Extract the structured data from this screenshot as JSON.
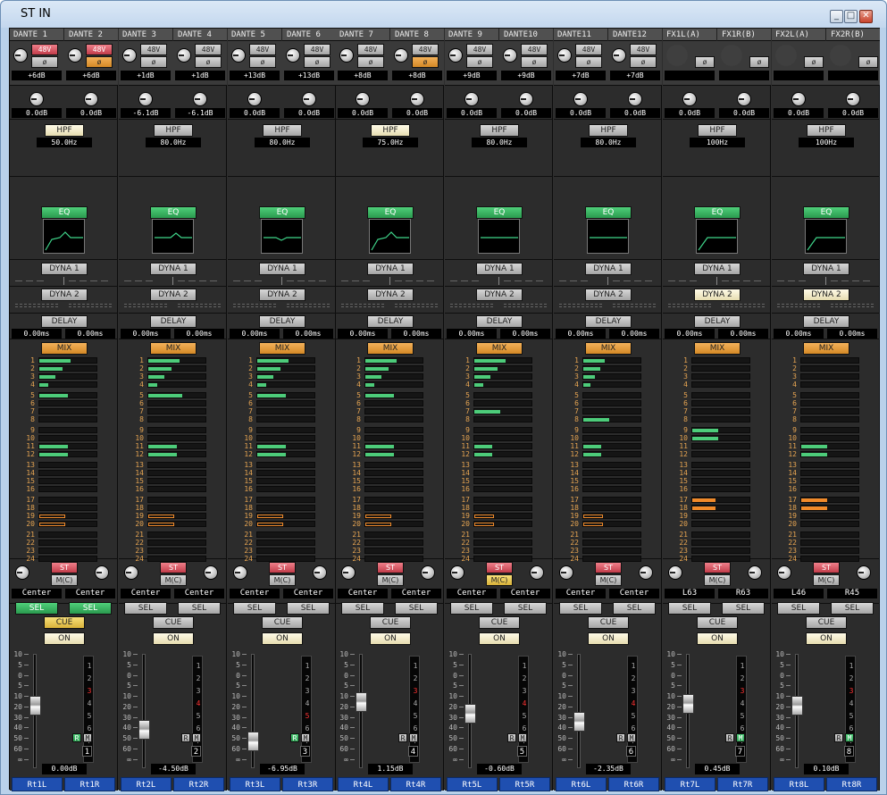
{
  "window": {
    "title": "ST IN"
  },
  "bus_numbers": [
    "1",
    "2",
    "3",
    "4",
    "5",
    "6",
    "7",
    "8",
    "9",
    "10",
    "11",
    "12",
    "13",
    "14",
    "15",
    "16",
    "17",
    "18",
    "19",
    "20",
    "21",
    "22",
    "23",
    "24"
  ],
  "fader_scale": [
    "10",
    "5",
    "0",
    "5",
    "10",
    "20",
    "30",
    "40",
    "50",
    "60",
    "∞"
  ],
  "meter_scale": [
    "1",
    "2",
    "3",
    "4",
    "5",
    "6",
    "7",
    "8"
  ],
  "labels": {
    "hpf": "HPF",
    "eq": "EQ",
    "dyna1": "DYNA 1",
    "dyna2": "DYNA 2",
    "delay": "DELAY",
    "mix": "MIX",
    "st": "ST",
    "mono": "M(C)",
    "sel": "SEL",
    "cue": "CUE",
    "on": "ON",
    "ph": "48V",
    "phase": "ø",
    "r": "R",
    "m": "M"
  },
  "colors": {
    "send_green": "#4dcc7a",
    "send_orange": "#f08a2a",
    "meter_red": "#ff3333"
  },
  "strips": [
    {
      "name_l": "DANTE 1",
      "name_r": "DANTE 2",
      "gain_l": "+6dB",
      "gain_r": "+6dB",
      "trim_l": "0.0dB",
      "trim_r": "0.0dB",
      "hpf": "50.0Hz",
      "hpf_on": true,
      "eq_curve": "hpf-peak",
      "dyna2_on": false,
      "delay_l": "0.00ms",
      "delay_r": "0.00ms",
      "pan_l": "Center",
      "pan_r": "Center",
      "sel_on": true,
      "cue_on": true,
      "mono_on": false,
      "fader_db": "0.00dB",
      "fader_level": 0.78,
      "number": "1",
      "patch_l": "Rt1L",
      "patch_r": "Rt1R",
      "r_on": true,
      "m_on": false,
      "ph_l": "red",
      "ph_r": "red",
      "phase_r_on": true,
      "has_input": true,
      "sends": [
        [
          0.55,
          "g"
        ],
        [
          0.4,
          "g"
        ],
        [
          0.28,
          "g"
        ],
        [
          0.15,
          "g"
        ],
        [
          0.5,
          "g"
        ],
        [
          0,
          ""
        ],
        [
          0,
          ""
        ],
        [
          0,
          ""
        ],
        [
          0,
          ""
        ],
        [
          0,
          ""
        ],
        [
          0.5,
          "g"
        ],
        [
          0.5,
          "g"
        ],
        [
          0,
          ""
        ],
        [
          0,
          ""
        ],
        [
          0,
          ""
        ],
        [
          0,
          ""
        ],
        [
          0,
          ""
        ],
        [
          0,
          ""
        ],
        [
          0.45,
          "o"
        ],
        [
          0.45,
          "o"
        ],
        [
          0,
          ""
        ],
        [
          0,
          ""
        ],
        [
          0,
          ""
        ],
        [
          0,
          ""
        ]
      ]
    },
    {
      "name_l": "DANTE 3",
      "name_r": "DANTE 4",
      "gain_l": "+1dB",
      "gain_r": "+1dB",
      "trim_l": "-6.1dB",
      "trim_r": "-6.1dB",
      "hpf": "80.0Hz",
      "hpf_on": false,
      "eq_curve": "peak",
      "dyna2_on": false,
      "delay_l": "0.00ms",
      "delay_r": "0.00ms",
      "pan_l": "Center",
      "pan_r": "Center",
      "sel_on": false,
      "cue_on": false,
      "mono_on": false,
      "fader_db": "-4.50dB",
      "fader_level": 0.66,
      "number": "2",
      "patch_l": "Rt2L",
      "patch_r": "Rt2R",
      "r_on": false,
      "m_on": false,
      "ph_l": "grey",
      "ph_r": "grey",
      "phase_r_on": false,
      "has_input": true,
      "sends": [
        [
          0.55,
          "g"
        ],
        [
          0.4,
          "g"
        ],
        [
          0.28,
          "g"
        ],
        [
          0.15,
          "g"
        ],
        [
          0.6,
          "g"
        ],
        [
          0,
          ""
        ],
        [
          0,
          ""
        ],
        [
          0,
          ""
        ],
        [
          0,
          ""
        ],
        [
          0,
          ""
        ],
        [
          0.5,
          "g"
        ],
        [
          0.5,
          "g"
        ],
        [
          0,
          ""
        ],
        [
          0,
          ""
        ],
        [
          0,
          ""
        ],
        [
          0,
          ""
        ],
        [
          0,
          ""
        ],
        [
          0,
          ""
        ],
        [
          0.45,
          "o"
        ],
        [
          0.45,
          "o"
        ],
        [
          0,
          ""
        ],
        [
          0,
          ""
        ],
        [
          0,
          ""
        ],
        [
          0,
          ""
        ]
      ]
    },
    {
      "name_l": "DANTE 5",
      "name_r": "DANTE 6",
      "gain_l": "+13dB",
      "gain_r": "+13dB",
      "trim_l": "0.0dB",
      "trim_r": "0.0dB",
      "hpf": "80.0Hz",
      "hpf_on": false,
      "eq_curve": "dip",
      "dyna2_on": false,
      "delay_l": "0.00ms",
      "delay_r": "0.00ms",
      "pan_l": "Center",
      "pan_r": "Center",
      "sel_on": false,
      "cue_on": false,
      "mono_on": false,
      "fader_db": "-6.95dB",
      "fader_level": 0.6,
      "number": "3",
      "patch_l": "Rt3L",
      "patch_r": "Rt3R",
      "r_on": true,
      "m_on": false,
      "ph_l": "grey",
      "ph_r": "grey",
      "phase_r_on": false,
      "has_input": true,
      "sends": [
        [
          0.55,
          "g"
        ],
        [
          0.4,
          "g"
        ],
        [
          0.28,
          "g"
        ],
        [
          0.15,
          "g"
        ],
        [
          0.5,
          "g"
        ],
        [
          0,
          ""
        ],
        [
          0,
          ""
        ],
        [
          0,
          ""
        ],
        [
          0,
          ""
        ],
        [
          0,
          ""
        ],
        [
          0.5,
          "g"
        ],
        [
          0.5,
          "g"
        ],
        [
          0,
          ""
        ],
        [
          0,
          ""
        ],
        [
          0,
          ""
        ],
        [
          0,
          ""
        ],
        [
          0,
          ""
        ],
        [
          0,
          ""
        ],
        [
          0.45,
          "o"
        ],
        [
          0.45,
          "o"
        ],
        [
          0,
          ""
        ],
        [
          0,
          ""
        ],
        [
          0,
          ""
        ],
        [
          0,
          ""
        ]
      ]
    },
    {
      "name_l": "DANTE 7",
      "name_r": "DANTE 8",
      "gain_l": "+8dB",
      "gain_r": "+8dB",
      "trim_l": "0.0dB",
      "trim_r": "0.0dB",
      "hpf": "75.0Hz",
      "hpf_on": true,
      "eq_curve": "hpf-peak",
      "dyna2_on": false,
      "delay_l": "0.00ms",
      "delay_r": "0.00ms",
      "pan_l": "Center",
      "pan_r": "Center",
      "sel_on": false,
      "cue_on": false,
      "mono_on": false,
      "fader_db": "1.15dB",
      "fader_level": 0.8,
      "number": "4",
      "patch_l": "Rt4L",
      "patch_r": "Rt4R",
      "r_on": false,
      "m_on": false,
      "ph_l": "grey",
      "ph_r": "grey",
      "phase_r_on": true,
      "has_input": true,
      "sends": [
        [
          0.55,
          "g"
        ],
        [
          0.4,
          "g"
        ],
        [
          0.28,
          "g"
        ],
        [
          0.15,
          "g"
        ],
        [
          0.5,
          "g"
        ],
        [
          0,
          ""
        ],
        [
          0,
          ""
        ],
        [
          0,
          ""
        ],
        [
          0,
          ""
        ],
        [
          0,
          ""
        ],
        [
          0.5,
          "g"
        ],
        [
          0.5,
          "g"
        ],
        [
          0,
          ""
        ],
        [
          0,
          ""
        ],
        [
          0,
          ""
        ],
        [
          0,
          ""
        ],
        [
          0,
          ""
        ],
        [
          0,
          ""
        ],
        [
          0.45,
          "o"
        ],
        [
          0.45,
          "o"
        ],
        [
          0,
          ""
        ],
        [
          0,
          ""
        ],
        [
          0,
          ""
        ],
        [
          0,
          ""
        ]
      ]
    },
    {
      "name_l": "DANTE 9",
      "name_r": "DANTE10",
      "gain_l": "+9dB",
      "gain_r": "+9dB",
      "trim_l": "0.0dB",
      "trim_r": "0.0dB",
      "hpf": "80.0Hz",
      "hpf_on": false,
      "eq_curve": "flat",
      "dyna2_on": false,
      "delay_l": "0.00ms",
      "delay_r": "0.00ms",
      "pan_l": "Center",
      "pan_r": "Center",
      "sel_on": false,
      "cue_on": false,
      "mono_on": true,
      "fader_db": "-0.60dB",
      "fader_level": 0.74,
      "number": "5",
      "patch_l": "Rt5L",
      "patch_r": "Rt5R",
      "r_on": false,
      "m_on": false,
      "ph_l": "grey",
      "ph_r": "grey",
      "phase_r_on": false,
      "has_input": true,
      "sends": [
        [
          0.55,
          "g"
        ],
        [
          0.4,
          "g"
        ],
        [
          0.28,
          "g"
        ],
        [
          0.15,
          "g"
        ],
        [
          0,
          ""
        ],
        [
          0,
          ""
        ],
        [
          0.45,
          "g"
        ],
        [
          0,
          ""
        ],
        [
          0,
          ""
        ],
        [
          0,
          ""
        ],
        [
          0.32,
          "g"
        ],
        [
          0.32,
          "g"
        ],
        [
          0,
          ""
        ],
        [
          0,
          ""
        ],
        [
          0,
          ""
        ],
        [
          0,
          ""
        ],
        [
          0,
          ""
        ],
        [
          0,
          ""
        ],
        [
          0.35,
          "o"
        ],
        [
          0.35,
          "o"
        ],
        [
          0,
          ""
        ],
        [
          0,
          ""
        ],
        [
          0,
          ""
        ],
        [
          0,
          ""
        ]
      ]
    },
    {
      "name_l": "DANTE11",
      "name_r": "DANTE12",
      "gain_l": "+7dB",
      "gain_r": "+7dB",
      "trim_l": "0.0dB",
      "trim_r": "0.0dB",
      "hpf": "80.0Hz",
      "hpf_on": false,
      "eq_curve": "flat",
      "dyna2_on": false,
      "delay_l": "0.00ms",
      "delay_r": "0.00ms",
      "pan_l": "Center",
      "pan_r": "Center",
      "sel_on": false,
      "cue_on": false,
      "mono_on": false,
      "fader_db": "-2.35dB",
      "fader_level": 0.7,
      "number": "6",
      "patch_l": "Rt6L",
      "patch_r": "Rt6R",
      "r_on": false,
      "m_on": false,
      "ph_l": "grey",
      "ph_r": "grey",
      "phase_r_on": false,
      "has_input": true,
      "sends": [
        [
          0.38,
          "g"
        ],
        [
          0.3,
          "g"
        ],
        [
          0.2,
          "g"
        ],
        [
          0.12,
          "g"
        ],
        [
          0,
          ""
        ],
        [
          0,
          ""
        ],
        [
          0,
          ""
        ],
        [
          0.45,
          "g"
        ],
        [
          0,
          ""
        ],
        [
          0,
          ""
        ],
        [
          0.32,
          "g"
        ],
        [
          0.32,
          "g"
        ],
        [
          0,
          ""
        ],
        [
          0,
          ""
        ],
        [
          0,
          ""
        ],
        [
          0,
          ""
        ],
        [
          0,
          ""
        ],
        [
          0,
          ""
        ],
        [
          0.35,
          "o"
        ],
        [
          0.35,
          "o"
        ],
        [
          0,
          ""
        ],
        [
          0,
          ""
        ],
        [
          0,
          ""
        ],
        [
          0,
          ""
        ]
      ]
    },
    {
      "name_l": "FX1L(A)",
      "name_r": "FX1R(B)",
      "gain_l": "",
      "gain_r": "",
      "trim_l": "0.0dB",
      "trim_r": "0.0dB",
      "hpf": "100Hz",
      "hpf_on": false,
      "eq_curve": "hpf",
      "dyna2_on": true,
      "delay_l": "0.00ms",
      "delay_r": "0.00ms",
      "pan_l": "L63",
      "pan_r": "R63",
      "sel_on": false,
      "cue_on": false,
      "mono_on": false,
      "fader_db": "0.45dB",
      "fader_level": 0.79,
      "number": "7",
      "patch_l": "Rt7L",
      "patch_r": "Rt7R",
      "r_on": false,
      "m_on": true,
      "ph_l": "none",
      "ph_r": "none",
      "phase_r_on": false,
      "has_input": false,
      "sends": [
        [
          0,
          ""
        ],
        [
          0,
          ""
        ],
        [
          0,
          ""
        ],
        [
          0,
          ""
        ],
        [
          0,
          ""
        ],
        [
          0,
          ""
        ],
        [
          0,
          ""
        ],
        [
          0,
          ""
        ],
        [
          0.45,
          "g"
        ],
        [
          0.45,
          "g"
        ],
        [
          0,
          ""
        ],
        [
          0,
          ""
        ],
        [
          0,
          ""
        ],
        [
          0,
          ""
        ],
        [
          0,
          ""
        ],
        [
          0,
          ""
        ],
        [
          0.4,
          "o"
        ],
        [
          0.4,
          "o"
        ],
        [
          0,
          ""
        ],
        [
          0,
          ""
        ],
        [
          0,
          ""
        ],
        [
          0,
          ""
        ],
        [
          0,
          ""
        ],
        [
          0,
          ""
        ]
      ]
    },
    {
      "name_l": "FX2L(A)",
      "name_r": "FX2R(B)",
      "gain_l": "",
      "gain_r": "",
      "trim_l": "0.0dB",
      "trim_r": "0.0dB",
      "hpf": "100Hz",
      "hpf_on": false,
      "eq_curve": "hpf",
      "dyna2_on": true,
      "delay_l": "0.00ms",
      "delay_r": "0.00ms",
      "pan_l": "L46",
      "pan_r": "R45",
      "sel_on": false,
      "cue_on": false,
      "mono_on": false,
      "fader_db": "0.10dB",
      "fader_level": 0.78,
      "number": "8",
      "patch_l": "Rt8L",
      "patch_r": "Rt8R",
      "r_on": false,
      "m_on": true,
      "ph_l": "none",
      "ph_r": "none",
      "phase_r_on": false,
      "has_input": false,
      "sends": [
        [
          0,
          ""
        ],
        [
          0,
          ""
        ],
        [
          0,
          ""
        ],
        [
          0,
          ""
        ],
        [
          0,
          ""
        ],
        [
          0,
          ""
        ],
        [
          0,
          ""
        ],
        [
          0,
          ""
        ],
        [
          0,
          ""
        ],
        [
          0,
          ""
        ],
        [
          0.45,
          "g"
        ],
        [
          0.45,
          "g"
        ],
        [
          0,
          ""
        ],
        [
          0,
          ""
        ],
        [
          0,
          ""
        ],
        [
          0,
          ""
        ],
        [
          0.45,
          "o"
        ],
        [
          0.45,
          "o"
        ],
        [
          0,
          ""
        ],
        [
          0,
          ""
        ],
        [
          0,
          ""
        ],
        [
          0,
          ""
        ],
        [
          0,
          ""
        ],
        [
          0,
          ""
        ]
      ]
    }
  ]
}
